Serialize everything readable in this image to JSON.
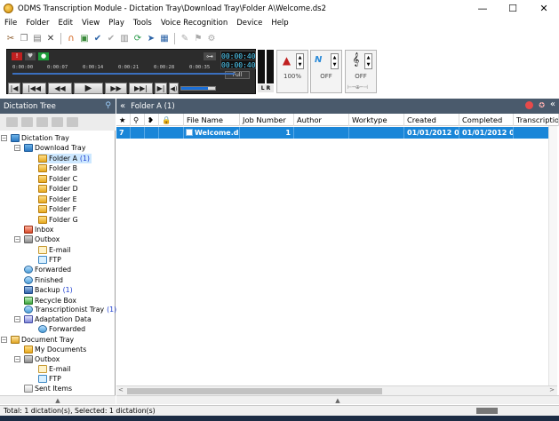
{
  "window": {
    "title": "ODMS Transcription Module - Dictation Tray\\Download Tray\\Folder A\\Welcome.ds2",
    "minimize_label": "—",
    "maximize_label": "☐",
    "close_label": "✕"
  },
  "menu": [
    "File",
    "Folder",
    "Edit",
    "View",
    "Play",
    "Tools",
    "Voice Recognition",
    "Device",
    "Help"
  ],
  "player": {
    "times": [
      "0:00:00",
      "0:00:07",
      "0:00:14",
      "0:00:21",
      "0:00:28",
      "0:00:35"
    ],
    "current_time": "00:00:40",
    "total_time": "00:00:40",
    "speed_mode": "Full",
    "lr_label": "L R",
    "volume_pct": "100%",
    "noise_label": "OFF",
    "tone_label": "OFF",
    "volume_fraction": 0.8
  },
  "tree": {
    "header": "Dictation Tree",
    "nodes": [
      {
        "label": "Dictation Tray",
        "count": "",
        "icon": "tray-icon"
      },
      {
        "label": "Download Tray",
        "count": "",
        "icon": "tray-icon"
      },
      {
        "label": "Folder A",
        "count": "(1)",
        "icon": "folder-a-icon"
      },
      {
        "label": "Folder B",
        "count": "",
        "icon": "folder-b-icon"
      },
      {
        "label": "Folder C",
        "count": "",
        "icon": "folder-c-icon"
      },
      {
        "label": "Folder D",
        "count": "",
        "icon": "folder-d-icon"
      },
      {
        "label": "Folder E",
        "count": "",
        "icon": "folder-e-icon"
      },
      {
        "label": "Folder F",
        "count": "",
        "icon": "folder-f-icon"
      },
      {
        "label": "Folder G",
        "count": "",
        "icon": "folder-g-icon"
      },
      {
        "label": "Inbox",
        "count": "",
        "icon": "inbox-icon"
      },
      {
        "label": "Outbox",
        "count": "",
        "icon": "outbox-icon"
      },
      {
        "label": "E-mail",
        "count": "",
        "icon": "email-icon"
      },
      {
        "label": "FTP",
        "count": "",
        "icon": "ftp-icon"
      },
      {
        "label": "Forwarded",
        "count": "",
        "icon": "forwarded-icon"
      },
      {
        "label": "Finished",
        "count": "",
        "icon": "finished-icon"
      },
      {
        "label": "Backup",
        "count": "(1)",
        "icon": "backup-icon"
      },
      {
        "label": "Recycle Box",
        "count": "",
        "icon": "recycle-icon"
      },
      {
        "label": "Transcriptionist Tray",
        "count": "(1)",
        "icon": "transcriptionist-icon"
      },
      {
        "label": "Adaptation Data",
        "count": "",
        "icon": "adaptation-icon"
      },
      {
        "label": "Forwarded",
        "count": "",
        "icon": "forwarded-icon"
      },
      {
        "label": "Document Tray",
        "count": "",
        "icon": "document-tray-icon"
      },
      {
        "label": "My Documents",
        "count": "",
        "icon": "folder-icon"
      },
      {
        "label": "Outbox",
        "count": "",
        "icon": "outbox-icon"
      },
      {
        "label": "E-mail",
        "count": "",
        "icon": "email-icon"
      },
      {
        "label": "FTP",
        "count": "",
        "icon": "ftp-icon"
      },
      {
        "label": "Sent Items",
        "count": "",
        "icon": "sent-icon"
      }
    ]
  },
  "list": {
    "header": "Folder A (1)",
    "columns": [
      "★",
      "⚲",
      "❥",
      "🔒",
      "File Name",
      "Job Number",
      "Author",
      "Worktype",
      "Created",
      "Completed",
      "Transcriptio..."
    ],
    "rows": [
      {
        "priority": "7",
        "file": "Welcome.ds2",
        "job": "1",
        "author": "",
        "worktype": "",
        "created": "01/01/2012 0...",
        "completed": "01/01/2012 0...",
        "transcription": ""
      }
    ]
  },
  "status": {
    "text": "Total: 1 dictation(s), Selected: 1 dictation(s)"
  },
  "colors": {
    "selection": "#1a86d8",
    "panel_header": "#4a5a6c",
    "count_text": "#2040d0"
  }
}
